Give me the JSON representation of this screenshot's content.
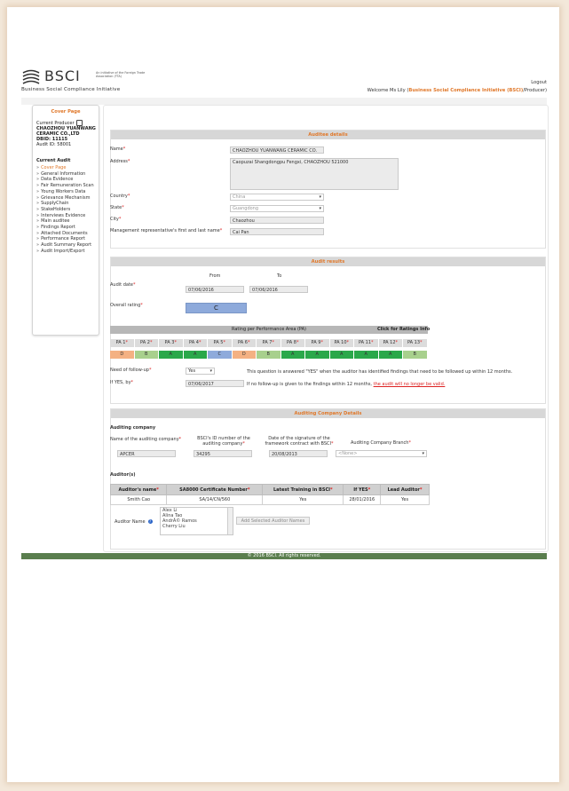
{
  "header": {
    "logo_text": "BSCI",
    "logo_subtitle": "An initiative of the Foreign Trade Association (FTA)",
    "logo_tagline": "Business Social Compliance Initiative",
    "logout": "Logout",
    "welcome_prefix": "Welcome Ms Lily (",
    "welcome_org": "Business Social Compliance Initiative (BSCI)",
    "welcome_suffix": "/Producer)"
  },
  "sidebar": {
    "title": "Cover Page",
    "producer_label": "Current Producer",
    "producer_name": "CHAOZHOU YUANWANG CERAMIC CO.,LTD",
    "dbid": "DBID: 11115",
    "audit_id": "Audit ID: 58001",
    "current_audit": "Current Audit",
    "items": [
      {
        "label": "Cover Page",
        "active": true
      },
      {
        "label": "General Information"
      },
      {
        "label": "Data Evidence"
      },
      {
        "label": "Fair Remuneration Scan"
      },
      {
        "label": "Young Workers Data"
      },
      {
        "label": "Grievance Mechanism"
      },
      {
        "label": "SupplyChain"
      },
      {
        "label": "StakeHolders"
      },
      {
        "label": "Interviews Evidence"
      },
      {
        "label": "Main auditee"
      },
      {
        "label": "Findings Report"
      },
      {
        "label": "Attached Documents"
      },
      {
        "label": "Performance Report"
      },
      {
        "label": "Audit Summary Report"
      },
      {
        "label": "Audit Import/Export"
      }
    ]
  },
  "auditee": {
    "title": "Auditee details",
    "name_label": "Name",
    "name_value": "CHAOZHOU YUANWANG CERAMIC CO.",
    "address_label": "Address",
    "address_value": "Caopuzai Shangdongpu Fengxi, CHAOZHOU 521000",
    "country_label": "Country",
    "country_value": "China",
    "state_label": "State",
    "state_value": "Guangdong",
    "city_label": "City",
    "city_value": "Chaozhou",
    "rep_label": "Management representative's first and last name",
    "rep_value": "Cai Pan"
  },
  "results": {
    "title": "Audit results",
    "from_label": "From",
    "to_label": "To",
    "audit_date_label": "Audit date",
    "from_value": "07/06/2016",
    "to_value": "07/06/2016",
    "overall_label": "Overall rating",
    "overall_value": "C",
    "pa_title": "Rating per Performance Area (PA)",
    "pa_click": "Click for Ratings Info",
    "pa_labels": [
      "PA 1",
      "PA 2",
      "PA 3",
      "PA 4",
      "PA 5",
      "PA 6",
      "PA 7",
      "PA 8",
      "PA 9",
      "PA 10",
      "PA 11",
      "PA 12",
      "PA 13"
    ],
    "pa_ratings": [
      "D",
      "B",
      "A",
      "A",
      "C",
      "D",
      "B",
      "A",
      "A",
      "A",
      "A",
      "A",
      "B"
    ],
    "rating_colors": {
      "A": "#2aa84a",
      "B": "#a8d08d",
      "C": "#8eaadb",
      "D": "#f4b183"
    },
    "followup_label": "Need of follow-up",
    "followup_value": "Yes",
    "followup_note": "This question is answered \"YES\" when the auditor has identified findings that need to be followed up within 12 months.",
    "ifyes_label": "If YES, by",
    "ifyes_value": "07/06/2017",
    "ifyes_note": "If no follow-up is given to the findings within 12 months,",
    "ifyes_warn": "the audit will no longer be valid."
  },
  "company": {
    "title": "Auditing Company Details",
    "sub": "Auditing company",
    "name_label": "Name of the auditing company",
    "name_value": "APCER",
    "id_label": "BSCI's ID number of the auditing company",
    "id_value": "34295",
    "date_label": "Date of the signature of the framework contract with BSCI",
    "date_value": "20/08/2013",
    "branch_label": "Auditing Company Branch",
    "branch_value": "<None>",
    "auditors_title": "Auditor(s)",
    "table_headers": [
      "Auditor's name",
      "SA8000 Certificate Number",
      "Latest Training in BSCI",
      "If YES",
      "Lead Auditor"
    ],
    "table_rows": [
      [
        "Smith Cao",
        "SA/14/CN/560",
        "Yes",
        "28/01/2016",
        "Yes"
      ]
    ],
    "auditor_name_label": "Auditor Name",
    "auditor_options": [
      "Alex Li",
      "Alina Tao",
      "AndrÃ© Ramos",
      "Cherry Liu"
    ],
    "add_button": "Add Selected Auditor Names"
  },
  "footer": "© 2016 BSCI. All rights reserved."
}
